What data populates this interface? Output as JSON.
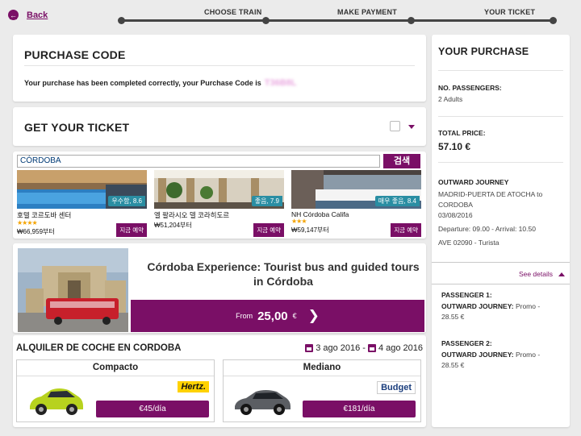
{
  "nav": {
    "back_label": "Back",
    "steps": [
      "CHOOSE TRAIN",
      "MAKE PAYMENT",
      "YOUR TICKET"
    ]
  },
  "purchase_code": {
    "title": "PURCHASE CODE",
    "message": "Your purchase has been completed correctly, your Purchase Code is",
    "code": "T36B8L"
  },
  "get_ticket": {
    "title": "GET YOUR TICKET"
  },
  "hotels": {
    "search_value": "CÓRDOBA",
    "search_button": "검색",
    "items": [
      {
        "name": "호텔 코르도바 센터",
        "score": "우수함, 8.6",
        "stars": "★★★★",
        "price": "₩66,959부터",
        "button": "지금 예약",
        "score_color": "#2a8ea3"
      },
      {
        "name": "엘 팔라시오 델 코라히도르",
        "score": "좋음, 7.9",
        "stars": "",
        "price": "₩51,204부터",
        "button": "지금 예약",
        "score_color": "#2a8ea3"
      },
      {
        "name": "NH Córdoba Califa",
        "score": "매우 좋음, 8.4",
        "stars": "★★★",
        "price": "₩59,147부터",
        "button": "지금 예약",
        "score_color": "#2a8ea3"
      }
    ]
  },
  "tour": {
    "title": "Córdoba Experience: Tourist bus and guided tours in Córdoba",
    "from_label": "From",
    "price": "25,00",
    "currency": "€"
  },
  "cars": {
    "title": "ALQUILER DE COCHE EN CORDOBA",
    "date_from": "3 ago 2016",
    "date_sep": "-",
    "date_to": "4 ago 2016",
    "items": [
      {
        "category": "Compacto",
        "brand": "Hertz.",
        "price": "€45/día"
      },
      {
        "category": "Mediano",
        "brand": "Budget",
        "price": "€181/día"
      }
    ]
  },
  "summary": {
    "title": "YOUR PURCHASE",
    "passengers_label": "NO. PASSENGERS:",
    "passengers_value": "2 Adults",
    "total_label": "TOTAL PRICE:",
    "total_value": "57.10 €",
    "journey_label": "OUTWARD JOURNEY",
    "journey_route_1": "MADRID-PUERTA DE ATOCHA to",
    "journey_route_2": "CORDOBA",
    "journey_date": "03/08/2016",
    "journey_times": "Departure: 09.00 - Arrival: 10.50",
    "journey_train": "AVE 02090 - Turista",
    "see_details": "See details",
    "passengers": [
      {
        "label": "PASSENGER 1:",
        "journey_label": "OUTWARD JOURNEY:",
        "fare": "Promo -",
        "price": "28.55 €"
      },
      {
        "label": "PASSENGER 2:",
        "journey_label": "OUTWARD JOURNEY:",
        "fare": "Promo -",
        "price": "28.55 €"
      }
    ]
  },
  "colors": {
    "accent": "#7a0f66",
    "score_badge": "#2a8ea3",
    "background": "#ebebeb"
  }
}
